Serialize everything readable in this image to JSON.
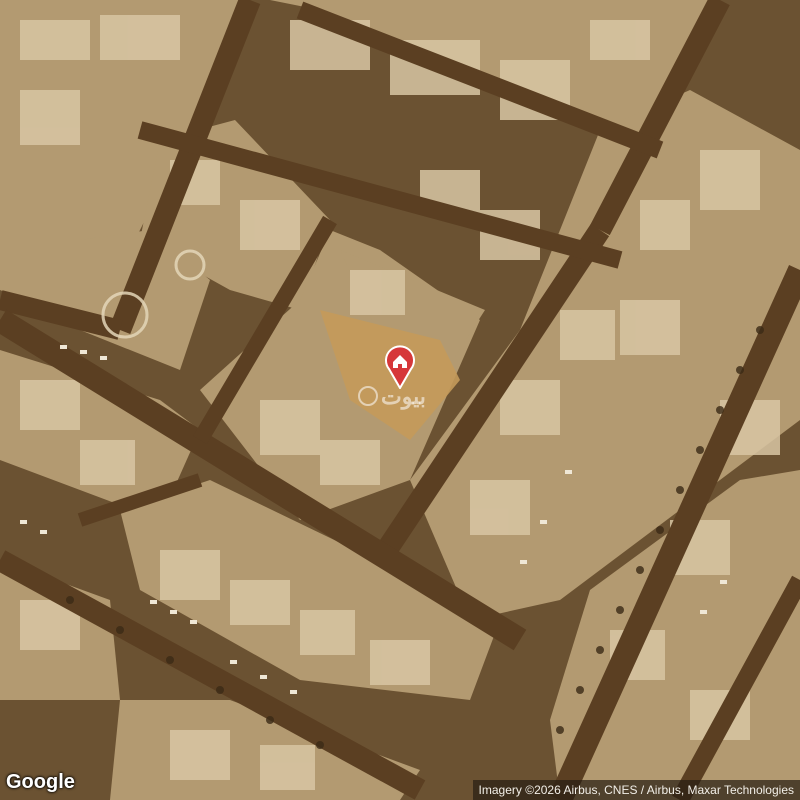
{
  "map": {
    "type": "satellite",
    "marker_icon": "home-pin-icon",
    "marker_color": "#d6373a",
    "watermark_text": "بيوت",
    "watermark_icon": "watermark-circle-icon",
    "google_logo_text": "Google",
    "attribution_text": "Imagery ©2026 Airbus, CNES / Airbus, Maxar Technologies",
    "colors": {
      "road": "#5b3f22",
      "block": "#b39a71",
      "building": "#d8c6a3",
      "empty_lot": "#c49a5a"
    }
  }
}
